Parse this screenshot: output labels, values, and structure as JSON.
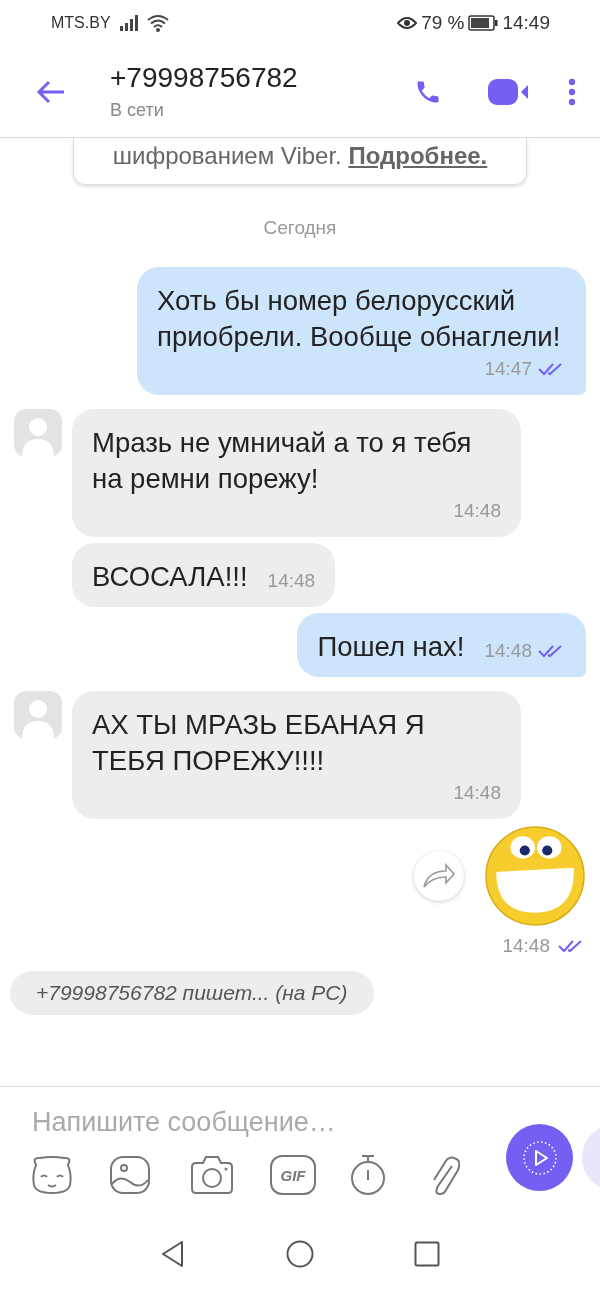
{
  "status_bar": {
    "carrier": "MTS.BY",
    "battery_percent": "79 %",
    "time": "14:49"
  },
  "header": {
    "title": "+79998756782",
    "subtitle": "В сети"
  },
  "encryption_notice": {
    "text": "шифрованием Viber. ",
    "link": "Подробнее."
  },
  "date_separator": "Сегодня",
  "messages": [
    {
      "kind": "outgoing",
      "text": "Хоть бы номер белорусский приобрели. Вообще обнаглели!",
      "time": "14:47",
      "read": true
    },
    {
      "kind": "incoming",
      "text": "Мразь не умничай а то я тебя на ремни порежу!",
      "time": "14:48",
      "show_avatar": true
    },
    {
      "kind": "incoming",
      "text": "ВСОСАЛА!!!",
      "time": "14:48",
      "show_avatar": false
    },
    {
      "kind": "outgoing",
      "text": "Пошел нах!",
      "time": "14:48",
      "read": true
    },
    {
      "kind": "incoming",
      "text": "АХ ТЫ МРАЗЬ ЕБАНАЯ Я ТЕБЯ ПОРЕЖУ!!!!",
      "time": "14:48",
      "show_avatar": true
    },
    {
      "kind": "sticker",
      "time": "14:48",
      "read": true
    }
  ],
  "typing_indicator": "+79998756782 пишет... (на PC)",
  "composer": {
    "placeholder": "Напишите сообщение…",
    "gif_icon_label": "GIF"
  }
}
